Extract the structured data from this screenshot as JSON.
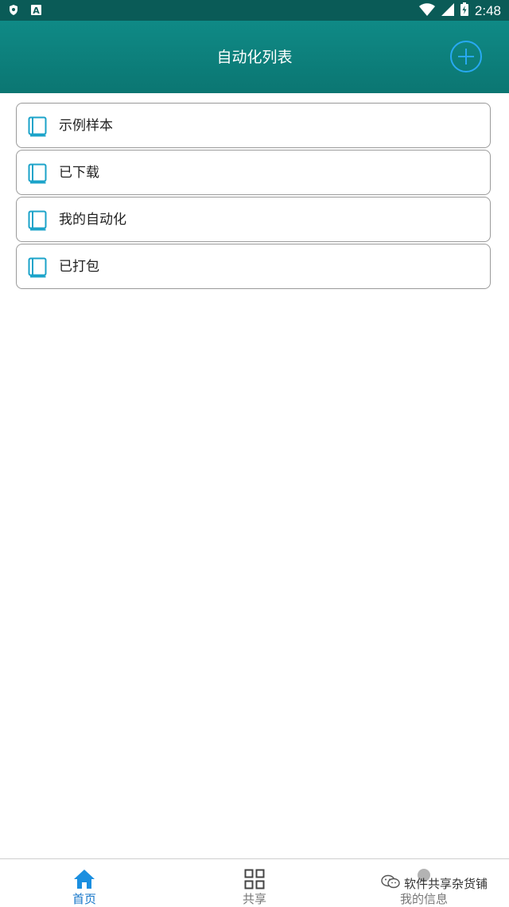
{
  "status_bar": {
    "time": "2:48",
    "left_icons": [
      "shield-icon",
      "a-icon"
    ],
    "right_icons": [
      "wifi-icon",
      "signal-icon",
      "battery-icon"
    ]
  },
  "app_bar": {
    "title": "自动化列表",
    "add_icon": "plus-circle-icon",
    "accent_color": "#28a9f2",
    "background_color": "#0b7d79"
  },
  "list": {
    "items": [
      {
        "label": "示例样本",
        "icon": "book-icon"
      },
      {
        "label": "已下载",
        "icon": "book-icon"
      },
      {
        "label": "我的自动化",
        "icon": "book-icon"
      },
      {
        "label": "已打包",
        "icon": "book-icon"
      }
    ]
  },
  "tab_bar": {
    "tabs": [
      {
        "label": "首页",
        "icon": "home-icon",
        "active": true
      },
      {
        "label": "共享",
        "icon": "grid-icon",
        "active": false
      },
      {
        "label": "我的信息",
        "icon": "user-icon",
        "active": false
      }
    ]
  },
  "watermark": {
    "text": "软件共享杂货铺",
    "icon": "wechat-icon"
  }
}
